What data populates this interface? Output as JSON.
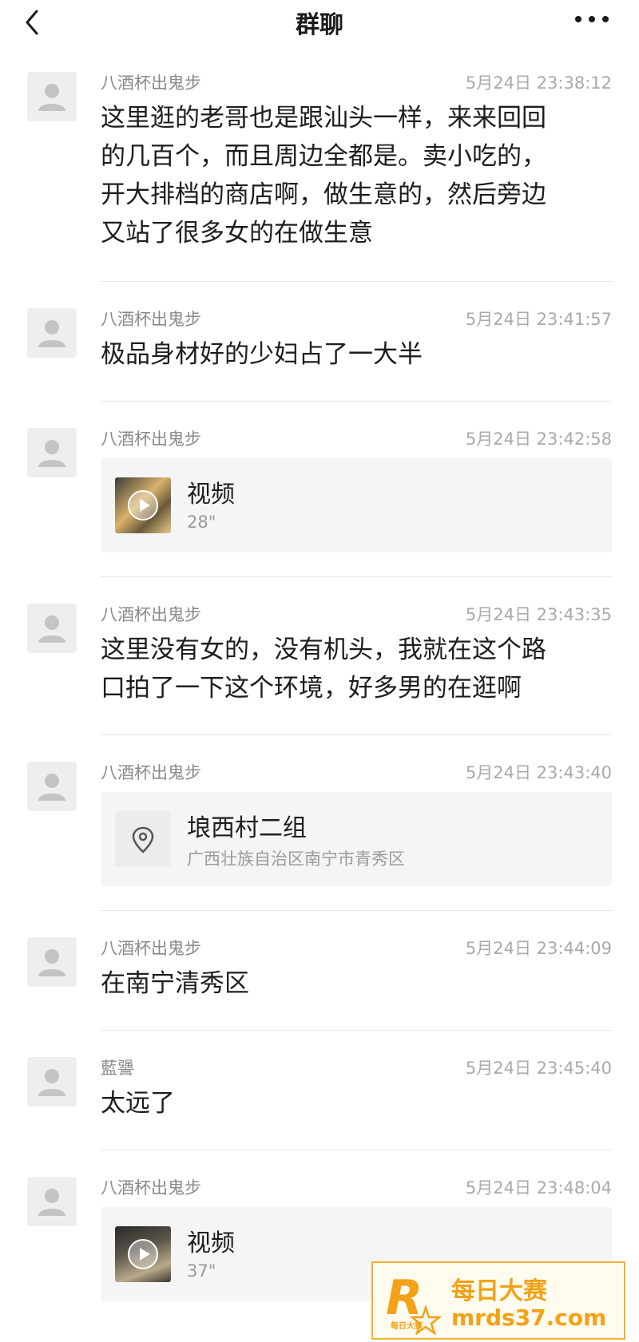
{
  "header": {
    "title": "群聊",
    "back_icon": "chevron-left-icon",
    "more_icon": "ellipsis-icon"
  },
  "messages": [
    {
      "type": "text",
      "sender": "八酒杯出鬼步",
      "time": "5月24日 23:38:12",
      "lines": [
        "这里逛的老哥也是跟汕头一样，来来回回",
        "的几百个，而且周边全都是。卖小吃的，",
        "开大排档的商店啊，做生意的，然后旁边",
        "又站了很多女的在做生意"
      ]
    },
    {
      "type": "text",
      "sender": "八酒杯出鬼步",
      "time": "5月24日 23:41:57",
      "lines": [
        "极品身材好的少妇占了一大半"
      ]
    },
    {
      "type": "video",
      "sender": "八酒杯出鬼步",
      "time": "5月24日 23:42:58",
      "title": "视频",
      "duration": "28\""
    },
    {
      "type": "text",
      "sender": "八酒杯出鬼步",
      "time": "5月24日 23:43:35",
      "lines": [
        "这里没有女的，没有机头，我就在这个路",
        "口拍了一下这个环境，好多男的在逛啊"
      ]
    },
    {
      "type": "location",
      "sender": "八酒杯出鬼步",
      "time": "5月24日 23:43:40",
      "title": "埌西村二组",
      "address": "广西壮族自治区南宁市青秀区"
    },
    {
      "type": "text",
      "sender": "八酒杯出鬼步",
      "time": "5月24日 23:44:09",
      "lines": [
        "在南宁清秀区"
      ]
    },
    {
      "type": "text",
      "sender": "藍謽",
      "time": "5月24日 23:45:40",
      "lines": [
        "太远了"
      ]
    },
    {
      "type": "video",
      "sender": "八酒杯出鬼步",
      "time": "5月24日 23:48:04",
      "title": "视频",
      "duration": "37\""
    }
  ],
  "watermark": {
    "logo_letter": "R",
    "logo_caption": "每日大赛",
    "name": "每日大赛",
    "url": "mrds37.com",
    "color": "#f3a117"
  }
}
